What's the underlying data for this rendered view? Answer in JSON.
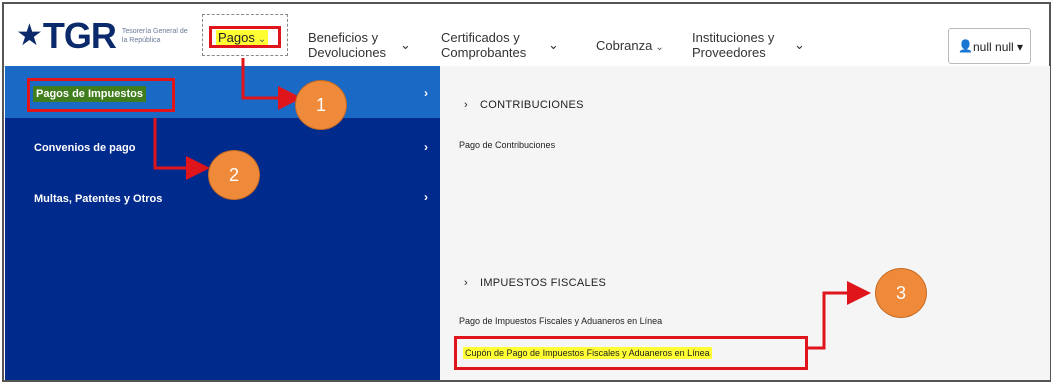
{
  "header": {
    "logo": {
      "main": "TGR",
      "sub": "Tesorería General de la República"
    },
    "nav": [
      {
        "label": "Pagos"
      },
      {
        "label_line1": "Beneficios y",
        "label_line2": "Devoluciones"
      },
      {
        "label_line1": "Certificados y",
        "label_line2": "Comprobantes"
      },
      {
        "label": "Cobranza"
      },
      {
        "label_line1": "Instituciones y",
        "label_line2": "Proveedores"
      }
    ],
    "user": {
      "label": "null null"
    }
  },
  "left_menu": {
    "items": [
      {
        "label": "Pagos de Impuestos"
      },
      {
        "label": "Convenios de pago"
      },
      {
        "label": "Multas, Patentes y Otros"
      }
    ]
  },
  "right_panel": {
    "sections": [
      {
        "title": "CONTRIBUCIONES",
        "links": [
          "Pago de Contribuciones"
        ]
      },
      {
        "title": "IMPUESTOS FISCALES",
        "links": [
          "Pago de Impuestos Fiscales y Aduaneros en Línea",
          "Cupón de Pago de Impuestos Fiscales y Aduaneros en Línea"
        ]
      }
    ]
  },
  "callouts": [
    "1",
    "2",
    "3"
  ],
  "colors": {
    "highlight_red": "#e0151b",
    "callout_orange": "#ef8a3a",
    "menu_blue": "#002a8c"
  }
}
